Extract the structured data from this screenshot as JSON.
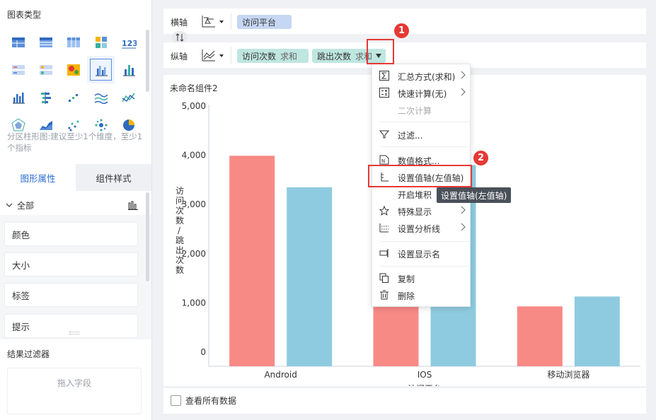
{
  "left_panel": {
    "chart_type_title": "图表类型",
    "chart_type_desc": "分区柱形图:建议至少1个维度，至少1个指标",
    "tabs": [
      "图形属性",
      "组件样式"
    ],
    "prop_all": "全部",
    "props": [
      "颜色",
      "大小",
      "标签",
      "提示"
    ],
    "filter_title": "结果过滤器",
    "filter_placeholder": "拖入字段"
  },
  "axes": {
    "x_label": "横轴",
    "x_field": "访问平台",
    "y_label": "纵轴",
    "y_fields": [
      {
        "name": "访问次数",
        "agg": "求和"
      },
      {
        "name": "跳出次数",
        "agg": "求和"
      }
    ]
  },
  "chart_panel": {
    "title": "未命名组件2",
    "show_all_label": "查看所有数据"
  },
  "chart_data": {
    "type": "bar",
    "categories": [
      "Android",
      "IOS",
      "移动浏览器"
    ],
    "series": [
      {
        "name": "访问次数",
        "values": [
          3990,
          2800,
          930
        ],
        "color": "#f88a86"
      },
      {
        "name": "跳出次数",
        "values": [
          3350,
          3800,
          1130
        ],
        "color": "#8fcbe0"
      }
    ],
    "xlabel": "访问平台",
    "ylabel": "访问次数/跳出次数",
    "yticks": [
      "5,000",
      "4,000",
      "3,000",
      "2,000",
      "1,000",
      "0"
    ],
    "ylim": [
      0,
      5000
    ]
  },
  "menu": {
    "items": [
      {
        "label": "汇总方式(求和)",
        "icon": "sigma-icon",
        "submenu": true
      },
      {
        "label": "快速计算(无)",
        "icon": "calc-icon",
        "submenu": true
      },
      {
        "label": "二次计算",
        "icon": "",
        "disabled": true
      },
      {
        "label": "过滤...",
        "icon": "filter-icon"
      },
      {
        "label": "数值格式...",
        "icon": "number-format-icon"
      },
      {
        "label": "设置值轴(左值轴)",
        "icon": "value-axis-icon"
      },
      {
        "label": "开启堆积",
        "icon": "stack-icon"
      },
      {
        "label": "特殊显示",
        "icon": "star-icon",
        "submenu": true
      },
      {
        "label": "设置分析线",
        "icon": "analysis-line-icon",
        "submenu": true
      },
      {
        "label": "设置显示名",
        "icon": "rename-icon"
      },
      {
        "label": "复制",
        "icon": "copy-icon"
      },
      {
        "label": "删除",
        "icon": "delete-icon"
      }
    ]
  },
  "tooltip": "设置值轴(左值轴)",
  "badges": [
    "1",
    "2"
  ]
}
